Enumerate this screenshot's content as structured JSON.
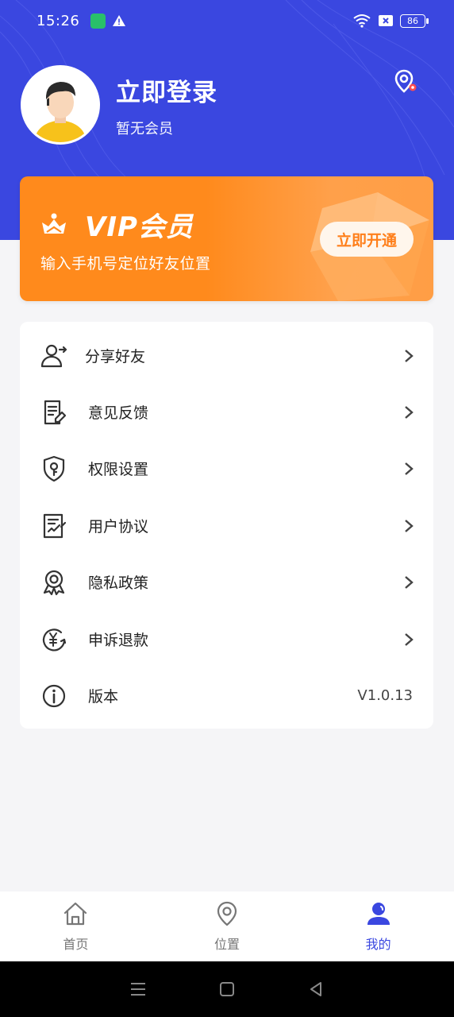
{
  "status_bar": {
    "time": "15:26",
    "battery": "86"
  },
  "profile": {
    "login_title": "立即登录",
    "member_status": "暂无会员"
  },
  "vip": {
    "title": "VIP会员",
    "subtitle": "输入手机号定位好友位置",
    "open_button": "立即开通"
  },
  "menu": [
    {
      "label": "分享好友",
      "icon": "share-friend-icon"
    },
    {
      "label": "意见反馈",
      "icon": "feedback-icon"
    },
    {
      "label": "权限设置",
      "icon": "permission-shield-icon"
    },
    {
      "label": "用户协议",
      "icon": "agreement-doc-icon"
    },
    {
      "label": "隐私政策",
      "icon": "privacy-badge-icon"
    },
    {
      "label": "申诉退款",
      "icon": "refund-yen-icon"
    },
    {
      "label": "版本",
      "icon": "info-icon",
      "value": "V1.0.13"
    }
  ],
  "tabs": [
    {
      "label": "首页",
      "icon": "home-icon",
      "active": false
    },
    {
      "label": "位置",
      "icon": "location-pin-icon",
      "active": false
    },
    {
      "label": "我的",
      "icon": "profile-icon",
      "active": true
    }
  ],
  "colors": {
    "primary": "#3a47e0",
    "vip_orange": "#ff8a1c",
    "background": "#f5f5f7"
  }
}
